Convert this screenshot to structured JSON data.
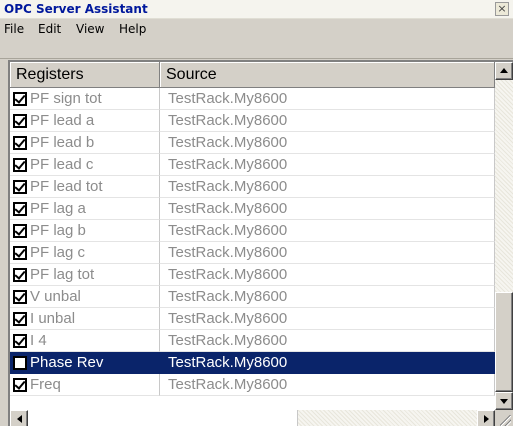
{
  "window": {
    "title": "OPC Server Assistant",
    "close_glyph": "×"
  },
  "menu": {
    "items": [
      "File",
      "Edit",
      "View",
      "Help"
    ]
  },
  "list": {
    "columns": [
      "Registers",
      "Source"
    ],
    "rows": [
      {
        "register": "PF sign tot",
        "source": "TestRack.My8600",
        "checked": true,
        "selected": false
      },
      {
        "register": "PF lead a",
        "source": "TestRack.My8600",
        "checked": true,
        "selected": false
      },
      {
        "register": "PF lead b",
        "source": "TestRack.My8600",
        "checked": true,
        "selected": false
      },
      {
        "register": "PF lead c",
        "source": "TestRack.My8600",
        "checked": true,
        "selected": false
      },
      {
        "register": "PF lead tot",
        "source": "TestRack.My8600",
        "checked": true,
        "selected": false
      },
      {
        "register": "PF lag a",
        "source": "TestRack.My8600",
        "checked": true,
        "selected": false
      },
      {
        "register": "PF lag b",
        "source": "TestRack.My8600",
        "checked": true,
        "selected": false
      },
      {
        "register": "PF lag c",
        "source": "TestRack.My8600",
        "checked": true,
        "selected": false
      },
      {
        "register": "PF lag tot",
        "source": "TestRack.My8600",
        "checked": true,
        "selected": false
      },
      {
        "register": "V unbal",
        "source": "TestRack.My8600",
        "checked": true,
        "selected": false
      },
      {
        "register": "I unbal",
        "source": "TestRack.My8600",
        "checked": true,
        "selected": false
      },
      {
        "register": "I 4",
        "source": "TestRack.My8600",
        "checked": true,
        "selected": false
      },
      {
        "register": "Phase Rev",
        "source": "TestRack.My8600",
        "checked": false,
        "selected": true
      },
      {
        "register": "Freq",
        "source": "TestRack.My8600",
        "checked": true,
        "selected": false
      }
    ]
  },
  "colors": {
    "title_text": "#00189c",
    "selection": "#0a246a",
    "row_text": "#8c8c8c",
    "face": "#d4d0c8"
  },
  "icons": [
    "close-icon",
    "checkbox-icon",
    "scroll-up-arrow-icon",
    "scroll-down-arrow-icon",
    "scroll-left-arrow-icon",
    "scroll-right-arrow-icon",
    "resize-grip-icon"
  ]
}
